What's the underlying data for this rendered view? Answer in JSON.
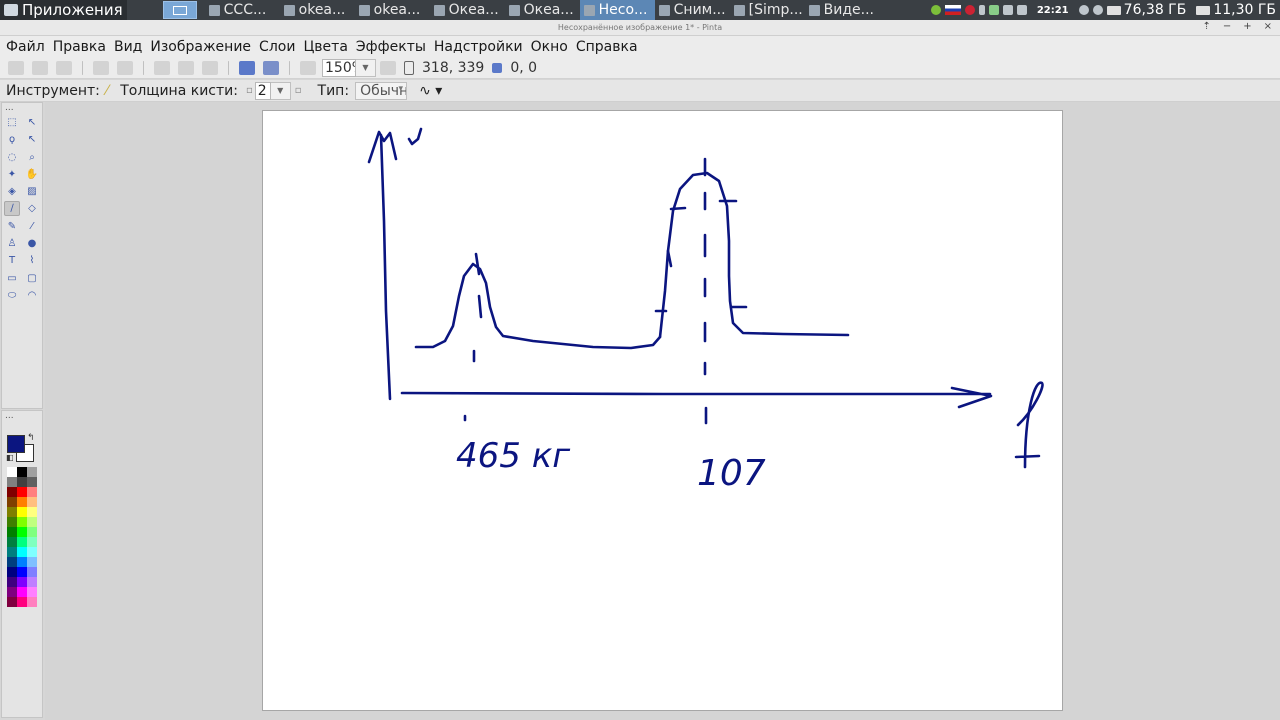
{
  "panel": {
    "apps_label": "Приложения",
    "tasks": [
      {
        "label": "CCC...",
        "active": false
      },
      {
        "label": "okea...",
        "active": false
      },
      {
        "label": "okea...",
        "active": false
      },
      {
        "label": "Океа...",
        "active": false
      },
      {
        "label": "Океа...",
        "active": false
      },
      {
        "label": "Несо...",
        "active": true
      },
      {
        "label": "Сним...",
        "active": false
      },
      {
        "label": "[Simp...",
        "active": false
      },
      {
        "label": "Виде...",
        "active": false
      }
    ],
    "clock": "22:21",
    "disk1": "76,38 ГБ",
    "disk2": "11,30 ГБ"
  },
  "window": {
    "title": "Несохранённое изображение 1* - Pinta",
    "buttons": [
      "⇡",
      "−",
      "+",
      "×"
    ]
  },
  "menu": {
    "items": [
      "Файл",
      "Правка",
      "Вид",
      "Изображение",
      "Слои",
      "Цвета",
      "Эффекты",
      "Надстройки",
      "Окно",
      "Справка"
    ]
  },
  "toolbar": {
    "zoom": "150%",
    "cursor_pos": "318, 339",
    "selection_size": "0, 0"
  },
  "options": {
    "tool_label": "Инструмент:",
    "brush_width_label": "Толщина кисти:",
    "brush_width": "2",
    "type_label": "Тип:",
    "type_value": "Обычн"
  },
  "tools": {
    "dots": "...",
    "items": [
      {
        "name": "rectangle-select-tool-icon",
        "glyph": "⬚"
      },
      {
        "name": "move-selected-tool-icon",
        "glyph": "↖"
      },
      {
        "name": "lasso-select-tool-icon",
        "glyph": "ϙ"
      },
      {
        "name": "move-selection-tool-icon",
        "glyph": "↖"
      },
      {
        "name": "ellipse-select-tool-icon",
        "glyph": "◌"
      },
      {
        "name": "zoom-tool-icon",
        "glyph": "⌕"
      },
      {
        "name": "magic-wand-tool-icon",
        "glyph": "✦"
      },
      {
        "name": "pan-tool-icon",
        "glyph": "✋"
      },
      {
        "name": "paint-bucket-tool-icon",
        "glyph": "◈"
      },
      {
        "name": "gradient-tool-icon",
        "glyph": "▨"
      },
      {
        "name": "paintbrush-tool-icon",
        "glyph": "∕"
      },
      {
        "name": "eraser-tool-icon",
        "glyph": "◇"
      },
      {
        "name": "pencil-tool-icon",
        "glyph": "✎"
      },
      {
        "name": "color-picker-tool-icon",
        "glyph": "⁄"
      },
      {
        "name": "clone-stamp-tool-icon",
        "glyph": "♙"
      },
      {
        "name": "recolor-tool-icon",
        "glyph": "●"
      },
      {
        "name": "text-tool-icon",
        "glyph": "T"
      },
      {
        "name": "line-curve-tool-icon",
        "glyph": "⌇"
      },
      {
        "name": "rectangle-tool-icon",
        "glyph": "▭"
      },
      {
        "name": "rounded-rectangle-tool-icon",
        "glyph": "▢"
      },
      {
        "name": "ellipse-tool-icon",
        "glyph": "⬭"
      },
      {
        "name": "freeform-shape-tool-icon",
        "glyph": "◠"
      }
    ]
  },
  "palette": {
    "dots": "...",
    "primary_color": "#0b1580",
    "secondary_color": "#ffffff",
    "swatches": [
      "#ffffff",
      "#000000",
      "#a0a0a0",
      "#808080",
      "#404040",
      "#606060",
      "#7f0000",
      "#ff0000",
      "#ff7f7f",
      "#7f3f00",
      "#ff7f00",
      "#ffbf7f",
      "#7f7f00",
      "#ffff00",
      "#ffff7f",
      "#3f7f00",
      "#7fff00",
      "#bfff7f",
      "#007f00",
      "#00ff00",
      "#7fff7f",
      "#007f3f",
      "#00ff7f",
      "#7fffbf",
      "#007f7f",
      "#00ffff",
      "#7fffff",
      "#003f7f",
      "#007fff",
      "#7fbfff",
      "#00007f",
      "#0000ff",
      "#7f7fff",
      "#3f007f",
      "#7f00ff",
      "#bf7fff",
      "#7f007f",
      "#ff00ff",
      "#ff7fff",
      "#7f003f",
      "#ff007f",
      "#ff7fbf"
    ]
  },
  "drawing": {
    "stroke_color": "#0b1580",
    "label_mass": "465 кг",
    "label_peak": "107",
    "axis_x": "f",
    "axis_y": "ν"
  }
}
